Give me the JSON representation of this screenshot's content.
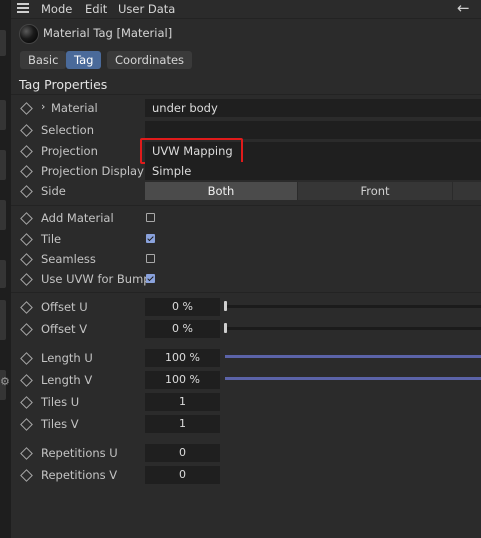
{
  "menubar": {
    "items": [
      "Mode",
      "Edit",
      "User Data"
    ]
  },
  "header": {
    "title": "Material Tag [Material]"
  },
  "tabs": [
    {
      "label": "Basic",
      "active": false
    },
    {
      "label": "Tag",
      "active": true
    },
    {
      "label": "Coordinates",
      "active": false
    }
  ],
  "section": {
    "title": "Tag Properties"
  },
  "props": {
    "material": {
      "label": "Material",
      "value": "under body"
    },
    "selection": {
      "label": "Selection",
      "value": ""
    },
    "projection": {
      "label": "Projection",
      "value": "UVW Mapping"
    },
    "projection_display": {
      "label": "Projection Display",
      "value": "Simple"
    },
    "side": {
      "label": "Side",
      "options": [
        "Both",
        "Front"
      ],
      "selected": "Both"
    },
    "add_material": {
      "label": "Add Material",
      "checked": false
    },
    "tile": {
      "label": "Tile",
      "checked": true
    },
    "seamless": {
      "label": "Seamless",
      "checked": false
    },
    "use_uvw_bump": {
      "label": "Use UVW for Bump",
      "checked": true
    },
    "offset_u": {
      "label": "Offset U",
      "value": "0 %",
      "fraction": 0
    },
    "offset_v": {
      "label": "Offset V",
      "value": "0 %",
      "fraction": 0
    },
    "length_u": {
      "label": "Length U",
      "value": "100 %",
      "fraction": 1
    },
    "length_v": {
      "label": "Length V",
      "value": "100 %",
      "fraction": 1
    },
    "tiles_u": {
      "label": "Tiles U",
      "value": "1"
    },
    "tiles_v": {
      "label": "Tiles V",
      "value": "1"
    },
    "repetitions_u": {
      "label": "Repetitions U",
      "value": "0"
    },
    "repetitions_v": {
      "label": "Repetitions V",
      "value": "0"
    }
  },
  "colors": {
    "accent": "#4a6a9a",
    "highlight": "#e01b1b",
    "slider": "#5b63a8"
  }
}
